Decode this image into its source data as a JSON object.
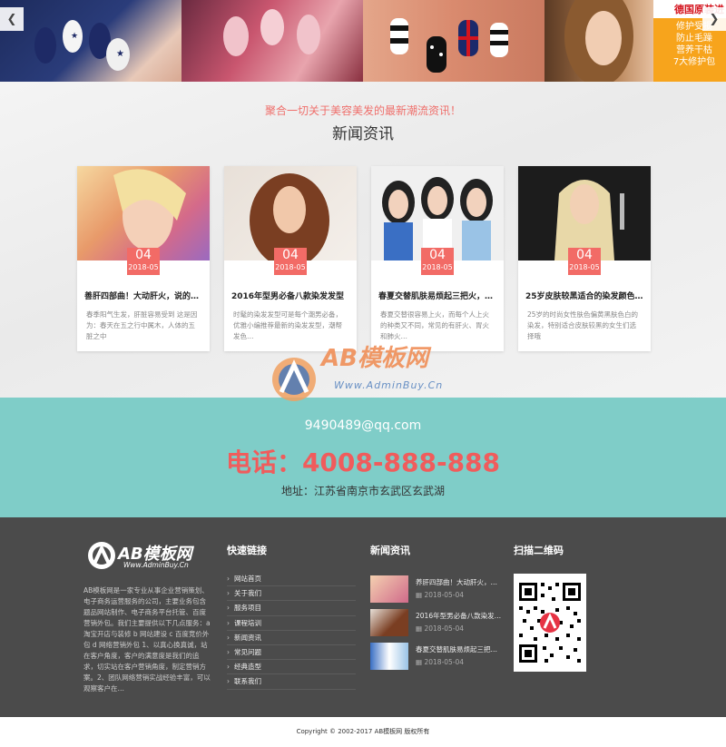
{
  "gallery": {
    "prev_icon": "chevron-left-icon",
    "next_icon": "chevron-right-icon",
    "promo": {
      "title": "德国原装进",
      "lines": [
        "修护受损",
        "防止毛躁",
        "营养干枯",
        "7大修护包"
      ]
    }
  },
  "news": {
    "tagline": "聚合一切关于美容美发的最新潮流资讯！",
    "title": "新闻资讯",
    "items": [
      {
        "day": "04",
        "ym": "2018-05",
        "title": "善肝四部曲！大动肝火，说的就…",
        "desc": "春季阳气生发，肝脏容易受到 这是因为：春天在五之行中属木，人体的五脏之中"
      },
      {
        "day": "04",
        "ym": "2018-05",
        "title": "2016年型男必备八款染发发型",
        "desc": "时髦的染发发型可是每个潮男必备，优雅小编推荐最新的染发发型，潮帮发色…"
      },
      {
        "day": "04",
        "ym": "2018-05",
        "title": "春夏交替肌肤易烦起三把火，掉…",
        "desc": "春夏交替很容易上火，而每个人上火的种类又不同，常见的有肝火、胃火和肺火…"
      },
      {
        "day": "04",
        "ym": "2018-05",
        "title": "25岁皮肤较黑适合的染发颜色，…",
        "desc": "25岁的时尚女性肤色偏黄黑肤色白的染发，特别适合皮肤较黑的女生们选择哦"
      }
    ]
  },
  "watermark": {
    "brand": "AB模板网",
    "url": "Www.AdminBuy.Cn"
  },
  "contact": {
    "email": "9490489@qq.com",
    "phone": "电话：4008-888-888",
    "address": "地址：江苏省南京市玄武区玄武湖"
  },
  "footer": {
    "logo_brand": "AB模板网",
    "logo_url": "Www.AdminBuy.Cn",
    "about": "AB模板网是一家专业从事企业营销策划、电子商务运营服务的公司，主要业务包含题品网站制作、电子商务平台托管、百度营销外包。我们主要提供以下几点服务：a 淘宝开店与装修 b 网站建设 c 百度竞价外包 d 网络营销外包 1、以真心换真诚，站在客户角度，客户的满意度是我们的追求，切实站在客户营销角度，制定营销方案。2、团队网络营销实战经验丰富，可以观察客户在…",
    "links_title": "快速链接",
    "links": [
      "网站首页",
      "关于我们",
      "服务项目",
      "课程培训",
      "新闻资讯",
      "常见问题",
      "经典造型",
      "联系我们"
    ],
    "news_title": "新闻资讯",
    "news": [
      {
        "title": "养肝四部曲！大动肝火，说…",
        "date": "2018-05-04"
      },
      {
        "title": "2016年型男必备八款染发…",
        "date": "2018-05-04"
      },
      {
        "title": "春夏交替肌肤易烦起三把火…",
        "date": "2018-05-04"
      }
    ],
    "qr_title": "扫描二维码",
    "copyright": "Copyright © 2002-2017 AB模板网 版权所有"
  },
  "colors": {
    "accent": "#f26b66",
    "teal": "#7fcdc8",
    "footer_bg": "#4b4b4b"
  }
}
